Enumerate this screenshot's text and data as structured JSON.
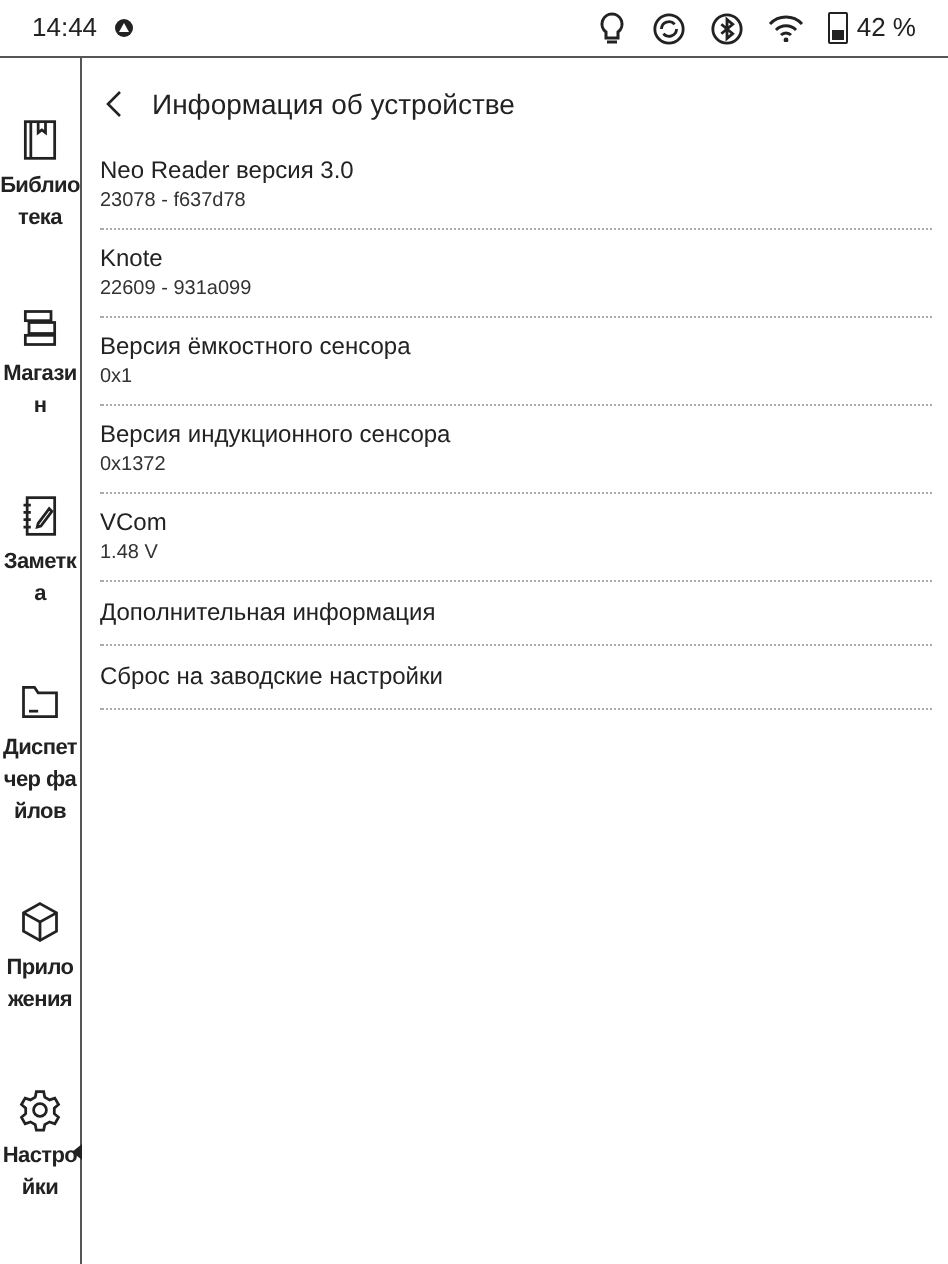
{
  "status_bar": {
    "time": "14:44",
    "battery_text": "42 %"
  },
  "sidebar": {
    "items": [
      {
        "label": "Библиотека",
        "kind": "book",
        "selected": false
      },
      {
        "label": "Магазин",
        "kind": "books",
        "selected": false
      },
      {
        "label": "Заметка",
        "kind": "note",
        "selected": false
      },
      {
        "label": "Диспетчер файлов",
        "kind": "folder",
        "selected": false
      },
      {
        "label": "Приложения",
        "kind": "cube",
        "selected": false
      },
      {
        "label": "Настройки",
        "kind": "gear",
        "selected": true
      }
    ]
  },
  "page": {
    "title": "Информация об устройстве",
    "rows": [
      {
        "title": "Neo Reader версия 3.0",
        "value": "23078 - f637d78"
      },
      {
        "title": "Knote",
        "value": "22609 - 931a099"
      },
      {
        "title": "Версия ёмкостного сенсора",
        "value": "0x1"
      },
      {
        "title": "Версия индукционного сенсора",
        "value": "0x1372"
      },
      {
        "title": "VCom",
        "value": "1.48 V"
      },
      {
        "title": "Дополнительная информация"
      },
      {
        "title": "Сброс на заводские настройки"
      }
    ]
  }
}
